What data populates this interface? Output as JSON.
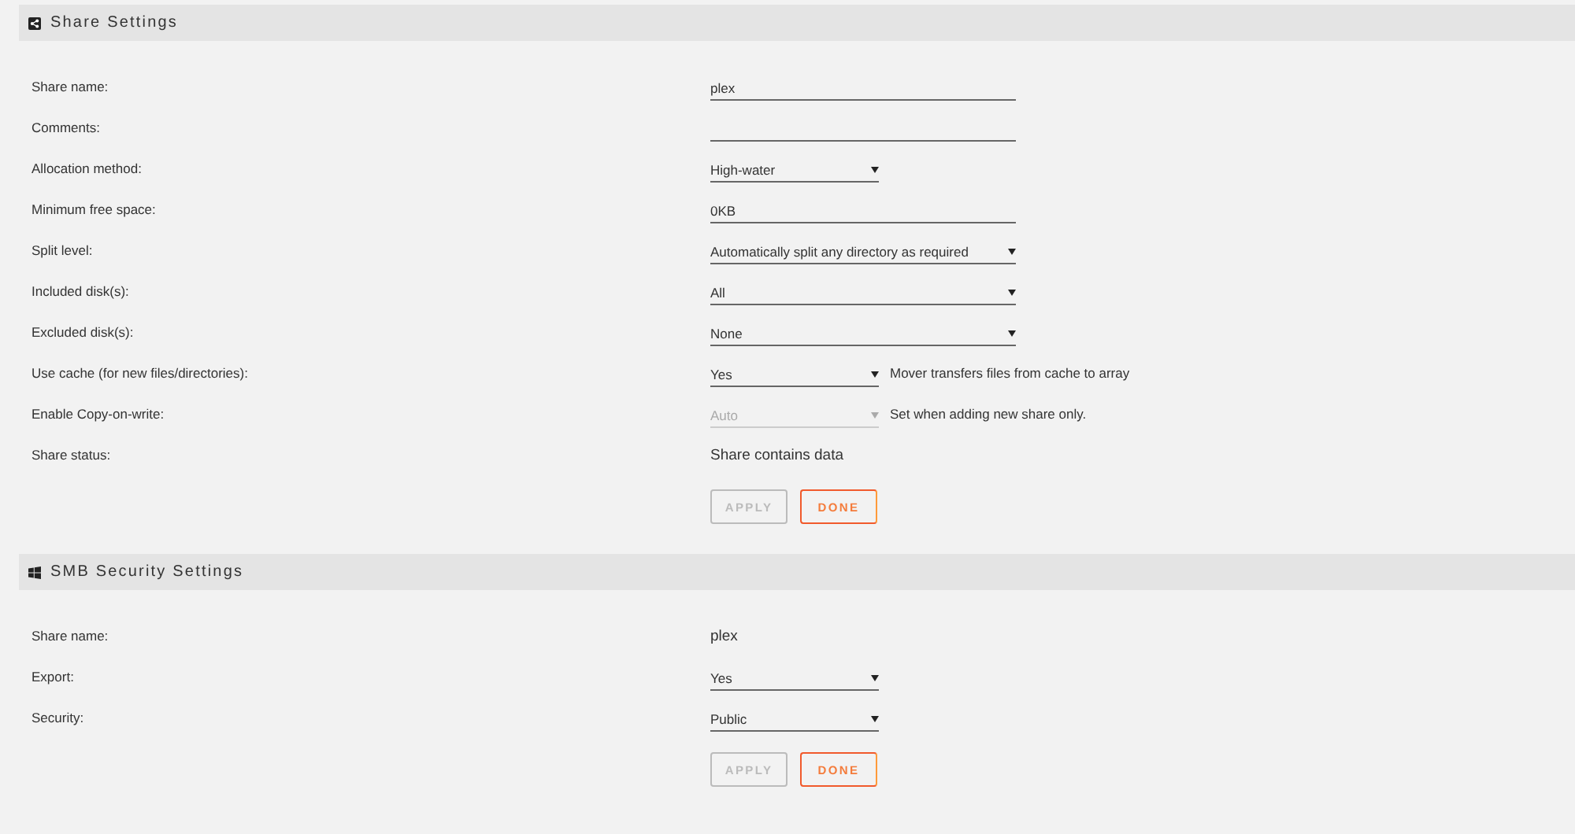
{
  "sections": [
    {
      "title": "Share Settings",
      "rows": [
        {
          "label": "Share name:",
          "kind": "text",
          "value": "plex"
        },
        {
          "label": "Comments:",
          "kind": "text",
          "value": ""
        },
        {
          "label": "Allocation method:",
          "kind": "select",
          "value": "High-water",
          "disabled": false
        },
        {
          "label": "Minimum free space:",
          "kind": "text",
          "value": "0KB"
        },
        {
          "label": "Split level:",
          "kind": "select",
          "value": "Automatically split any directory as required",
          "disabled": false
        },
        {
          "label": "Included disk(s):",
          "kind": "select",
          "value": "All",
          "disabled": false
        },
        {
          "label": "Excluded disk(s):",
          "kind": "select",
          "value": "None",
          "disabled": false
        },
        {
          "label": "Use cache (for new files/directories):",
          "kind": "select",
          "value": "Yes",
          "disabled": false,
          "note": "Mover transfers files from cache to array"
        },
        {
          "label": "Enable Copy-on-write:",
          "kind": "select",
          "value": "Auto",
          "disabled": true,
          "note": "Set when adding new share only."
        },
        {
          "label": "Share status:",
          "kind": "static",
          "value": "Share contains data"
        }
      ],
      "buttons": [
        {
          "label": "APPLY",
          "disabled": true
        },
        {
          "label": "DONE",
          "disabled": false
        }
      ]
    },
    {
      "title": "SMB Security Settings",
      "rows": [
        {
          "label": "Share name:",
          "kind": "static",
          "value": "plex"
        },
        {
          "label": "Export:",
          "kind": "select",
          "value": "Yes",
          "disabled": false
        },
        {
          "label": "Security:",
          "kind": "select",
          "value": "Public",
          "disabled": false
        }
      ],
      "buttons": [
        {
          "label": "APPLY",
          "disabled": true
        },
        {
          "label": "DONE",
          "disabled": false
        }
      ]
    }
  ]
}
